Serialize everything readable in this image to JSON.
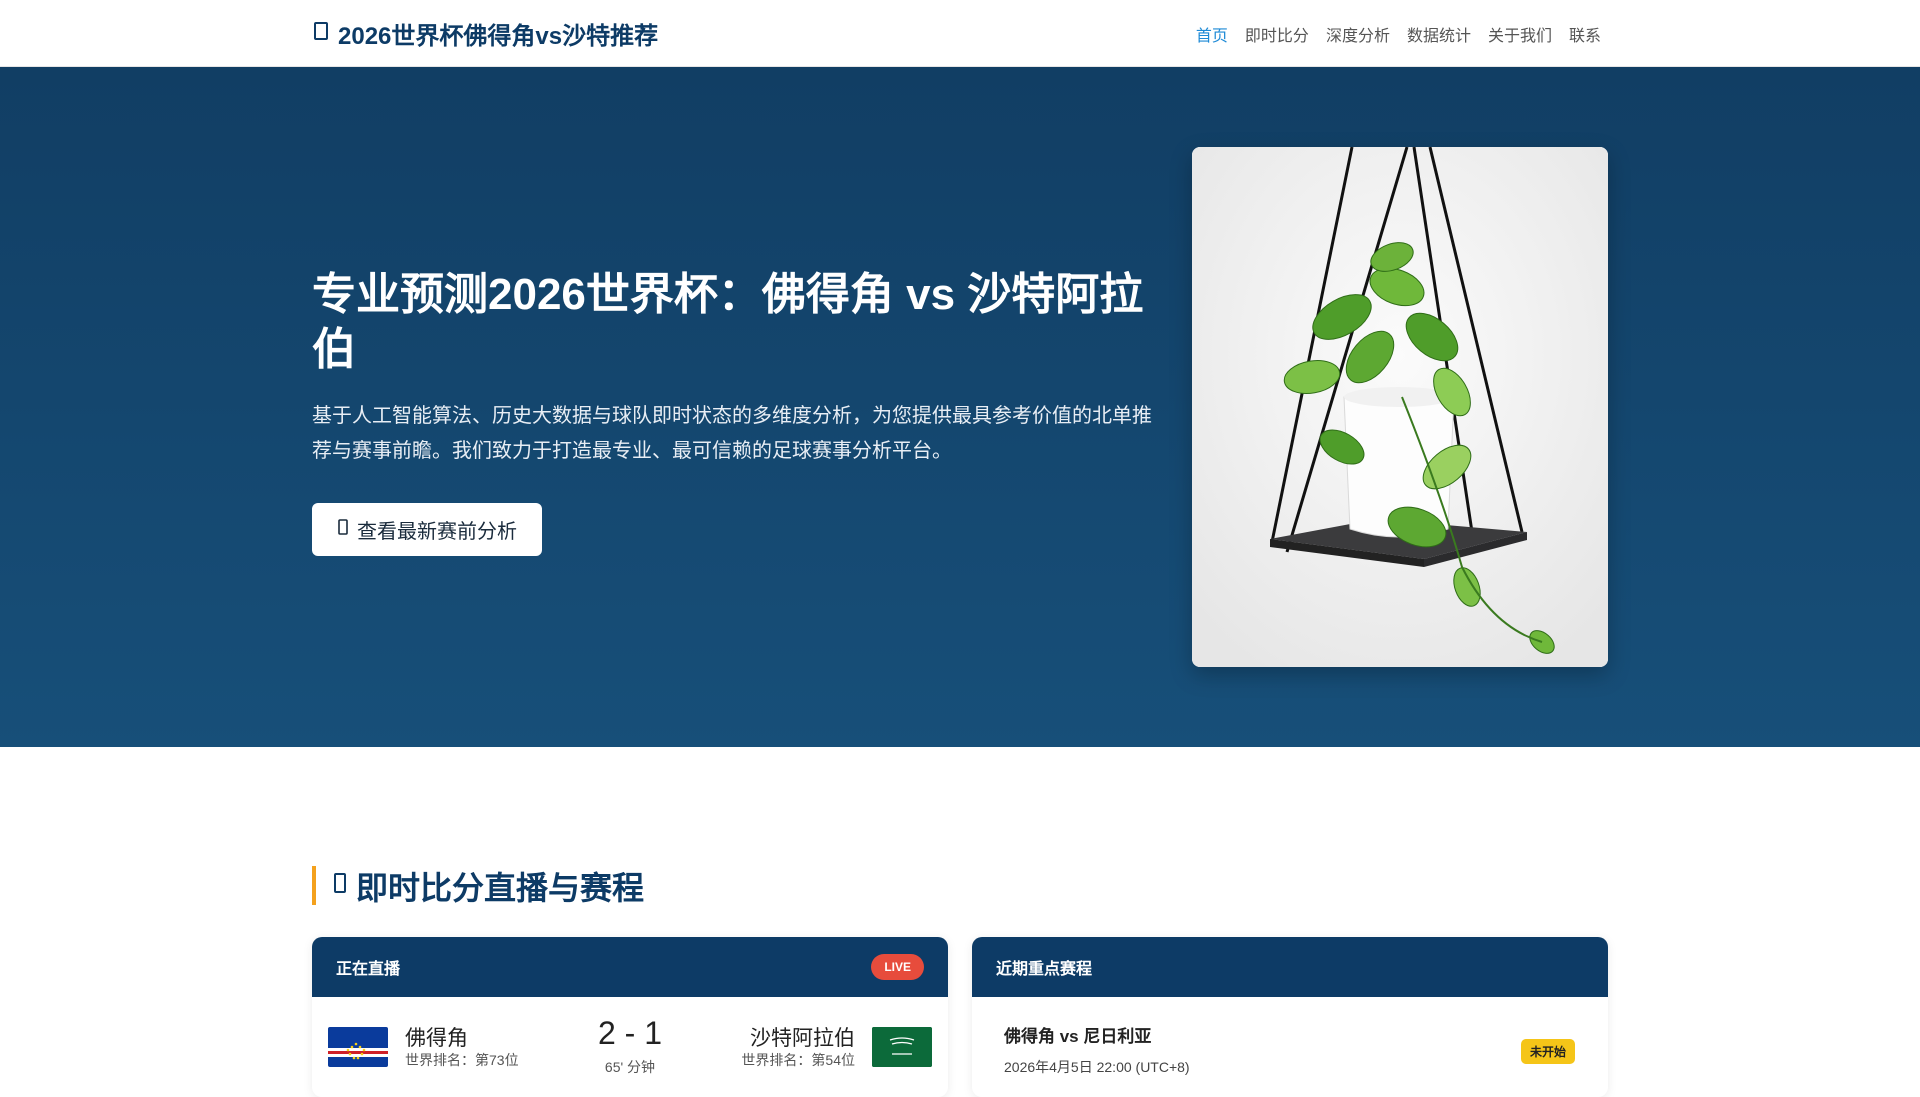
{
  "nav": {
    "brand_icon": "football-icon",
    "brand_title": "2026世界杯佛得角vs沙特推荐",
    "links": [
      "首页",
      "即时比分",
      "深度分析",
      "数据统计",
      "关于我们",
      "联系"
    ],
    "active_color": "#1e8ad6"
  },
  "hero": {
    "title": "专业预测2026世界杯：佛得角 vs 沙特阿拉伯",
    "description": "基于人工智能算法、历史大数据与球队即时状态的多维度分析，为您提供最具参考价值的北单推荐与赛事前瞻。我们致力于打造最专业、最可信赖的足球赛事分析平台。",
    "button_icon": "chart-icon",
    "button_label": "查看最新赛前分析",
    "background": "#113e64"
  },
  "section": {
    "icon": "stopwatch-icon",
    "title": "即时比分直播与赛程",
    "accent": "#f4a11d"
  },
  "live_card": {
    "header": "正在直播",
    "badge": "LIVE",
    "home": {
      "name": "佛得角",
      "rank": "世界排名：第73位"
    },
    "away": {
      "name": "沙特阿拉伯",
      "rank": "世界排名：第54位"
    },
    "score": "2 - 1",
    "minute": "65' 分钟"
  },
  "upcoming_card": {
    "header": "近期重点赛程",
    "match": "佛得角 vs 尼日利亚",
    "time": "2026年4月5日 22:00 (UTC+8)",
    "status": "未开始"
  }
}
